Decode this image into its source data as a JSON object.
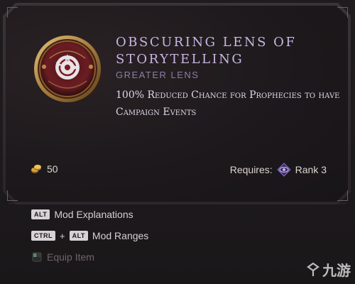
{
  "item": {
    "name": "Obscuring Lens of Storytelling",
    "type": "Greater Lens",
    "modifier": "100% Reduced Chance for Prophecies to have Campaign Events",
    "icon": "lens-icon"
  },
  "footer": {
    "cost_value": "50",
    "cost_icon": "gold-coin-icon",
    "requires_label": "Requires:",
    "rank_icon": "faction-eye-icon",
    "rank_text": "Rank 3"
  },
  "keybinds": [
    {
      "keys": [
        "ALT"
      ],
      "label": "Mod Explanations"
    },
    {
      "keys": [
        "CTRL",
        "ALT"
      ],
      "label": "Mod Ranges"
    },
    {
      "keys": [],
      "label": "Equip Item",
      "icon": "mouse-icon"
    }
  ],
  "watermark": {
    "text": "九游"
  },
  "colors": {
    "title": "#c8b6e2",
    "subtitle": "#8a7fa3",
    "modifier": "#ded9e8",
    "background": "#1a1719"
  }
}
